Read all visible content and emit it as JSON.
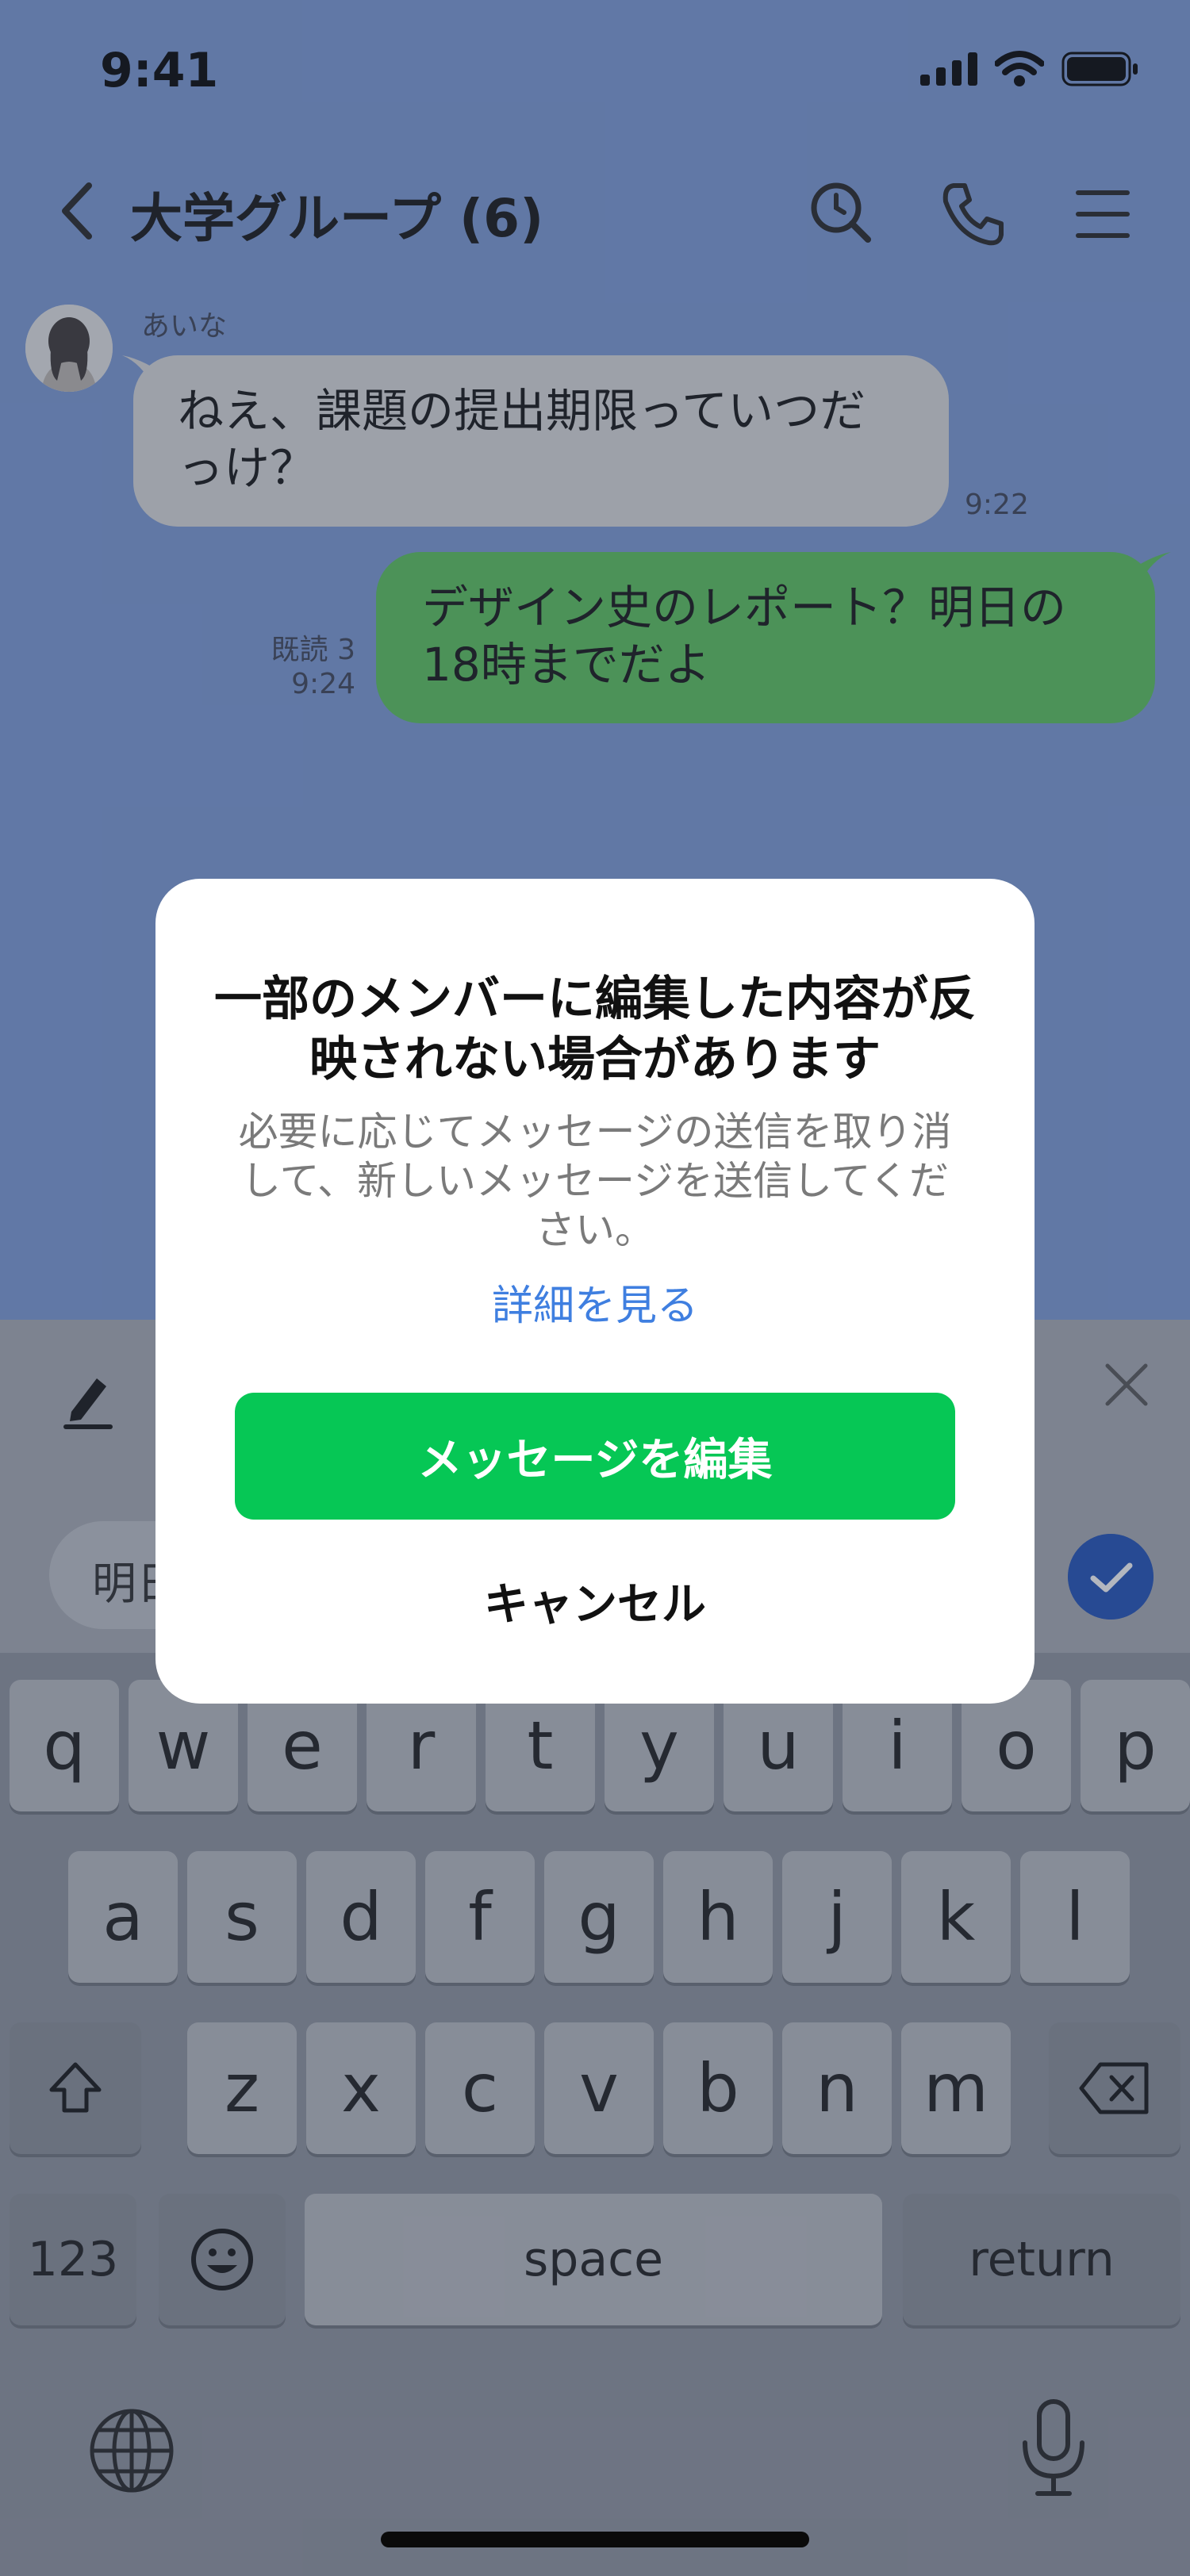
{
  "status_bar": {
    "time": "9:41"
  },
  "header": {
    "title": "大学グループ (6)"
  },
  "messages": [
    {
      "sender": "あいな",
      "text": "ねえ、課題の提出期限っていつだっけ？",
      "time": "9:22"
    },
    {
      "read": "既読 3",
      "time": "9:24",
      "text": "デザイン史のレポート？明日の18時までだよ"
    }
  ],
  "edit_bar": {
    "input_value": "明日"
  },
  "keyboard": {
    "row1": [
      "q",
      "w",
      "e",
      "r",
      "t",
      "y",
      "u",
      "i",
      "o",
      "p"
    ],
    "row2": [
      "a",
      "s",
      "d",
      "f",
      "g",
      "h",
      "j",
      "k",
      "l"
    ],
    "row3": [
      "z",
      "x",
      "c",
      "v",
      "b",
      "n",
      "m"
    ],
    "numbers_label": "123",
    "space_label": "space",
    "return_label": "return"
  },
  "dialog": {
    "title": "一部のメンバーに編集した内容が反映されない場合があります",
    "body": "必要に応じてメッセージの送信を取り消して、新しいメッセージを送信してください。",
    "link": "詳細を見る",
    "primary": "メッセージを編集",
    "cancel": "キャンセル"
  },
  "colors": {
    "chat_background": "#7b9ad6",
    "outgoing_bubble": "#5ac35a",
    "incoming_bubble": "#dcdcdc",
    "primary_button": "#06c755",
    "link": "#3f7fe0",
    "confirm_button": "#1d4fb8"
  },
  "icons": {
    "back": "chevron-left-icon",
    "search": "search-icon",
    "call": "phone-icon",
    "menu": "menu-icon",
    "edit": "pencil-icon",
    "close": "close-icon",
    "confirm": "checkmark-icon",
    "shift": "shift-icon",
    "delete": "backspace-icon",
    "emoji": "emoji-icon",
    "globe": "globe-icon",
    "mic": "microphone-icon"
  }
}
